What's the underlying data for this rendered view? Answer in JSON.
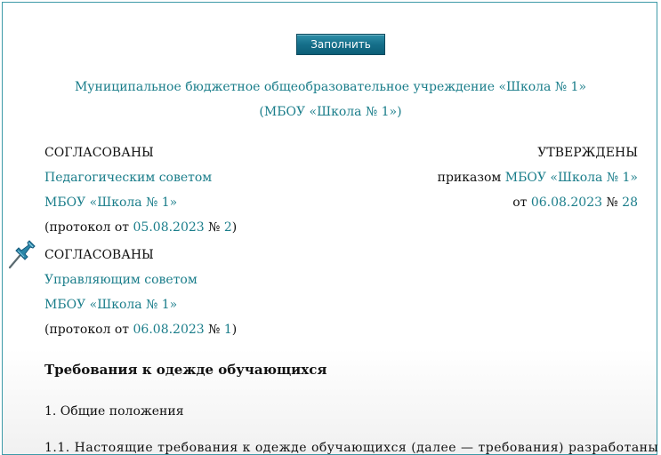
{
  "toolbar": {
    "fill_label": "Заполнить"
  },
  "org": {
    "full_name": "Муниципальное бюджетное общеобразовательное учреждение «Школа № 1»",
    "short_name": "(МБОУ «Школа № 1»)"
  },
  "approvals": {
    "agreed_1": {
      "title": "СОГЛАСОВАНЫ",
      "body": "Педагогическим советом",
      "org": "МБОУ «Школа № 1»",
      "protocol_prefix": "(протокол от ",
      "protocol_date": "05.08.2023",
      "protocol_no_sign": " № ",
      "protocol_number": "2",
      "protocol_suffix": ")"
    },
    "approved": {
      "title": "УТВЕРЖДЕНЫ",
      "order_prefix": "приказом ",
      "org": "МБОУ «Школа № 1»",
      "date_prefix": "от ",
      "date": "06.08.2023",
      "no_sign": " № ",
      "number": "28"
    },
    "agreed_2": {
      "title": "СОГЛАСОВАНЫ",
      "body": "Управляющим советом",
      "org": "МБОУ «Школа № 1»",
      "protocol_prefix": "(протокол от ",
      "protocol_date": "06.08.2023",
      "protocol_no_sign": " № ",
      "protocol_number": "1",
      "protocol_suffix": ")"
    }
  },
  "document": {
    "title": "Требования к одежде обучающихся",
    "section_1": "1. Общие положения",
    "partial_line": "1.1. Настоящие требования к одежде обучающихся (далее — требования) разработаны"
  },
  "icons": {
    "pin": "pushpin-icon"
  },
  "colors": {
    "link": "#1a7d8a",
    "button": "#156f8a",
    "border": "#3d9aa8"
  }
}
